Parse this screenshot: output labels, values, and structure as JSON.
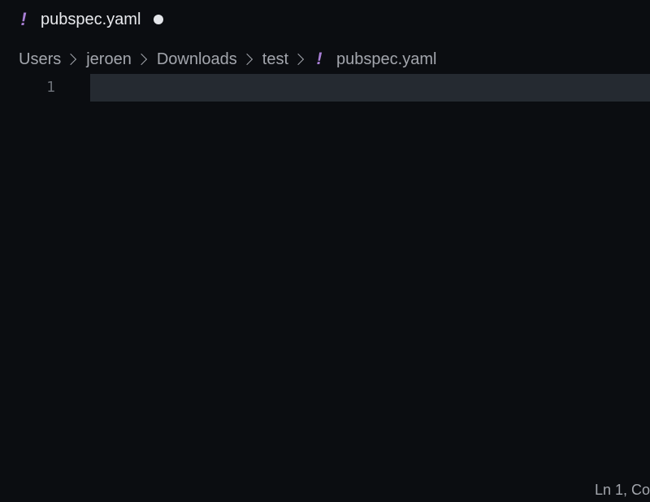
{
  "tab": {
    "icon": "yaml-file-icon",
    "glyph": "!",
    "title": "pubspec.yaml",
    "dirty": true
  },
  "breadcrumb": {
    "items": [
      "Users",
      "jeroen",
      "Downloads",
      "test"
    ],
    "file_glyph": "!",
    "file_name": "pubspec.yaml"
  },
  "editor": {
    "line_numbers": [
      "1"
    ],
    "lines": [
      ""
    ]
  },
  "status": {
    "position": "Ln 1, Co"
  },
  "colors": {
    "background": "#0b0d11",
    "current_line": "#252a31",
    "yaml_icon": "#a97fd6",
    "tab_text": "#e9eaee",
    "muted_text": "#a3a6ad"
  }
}
